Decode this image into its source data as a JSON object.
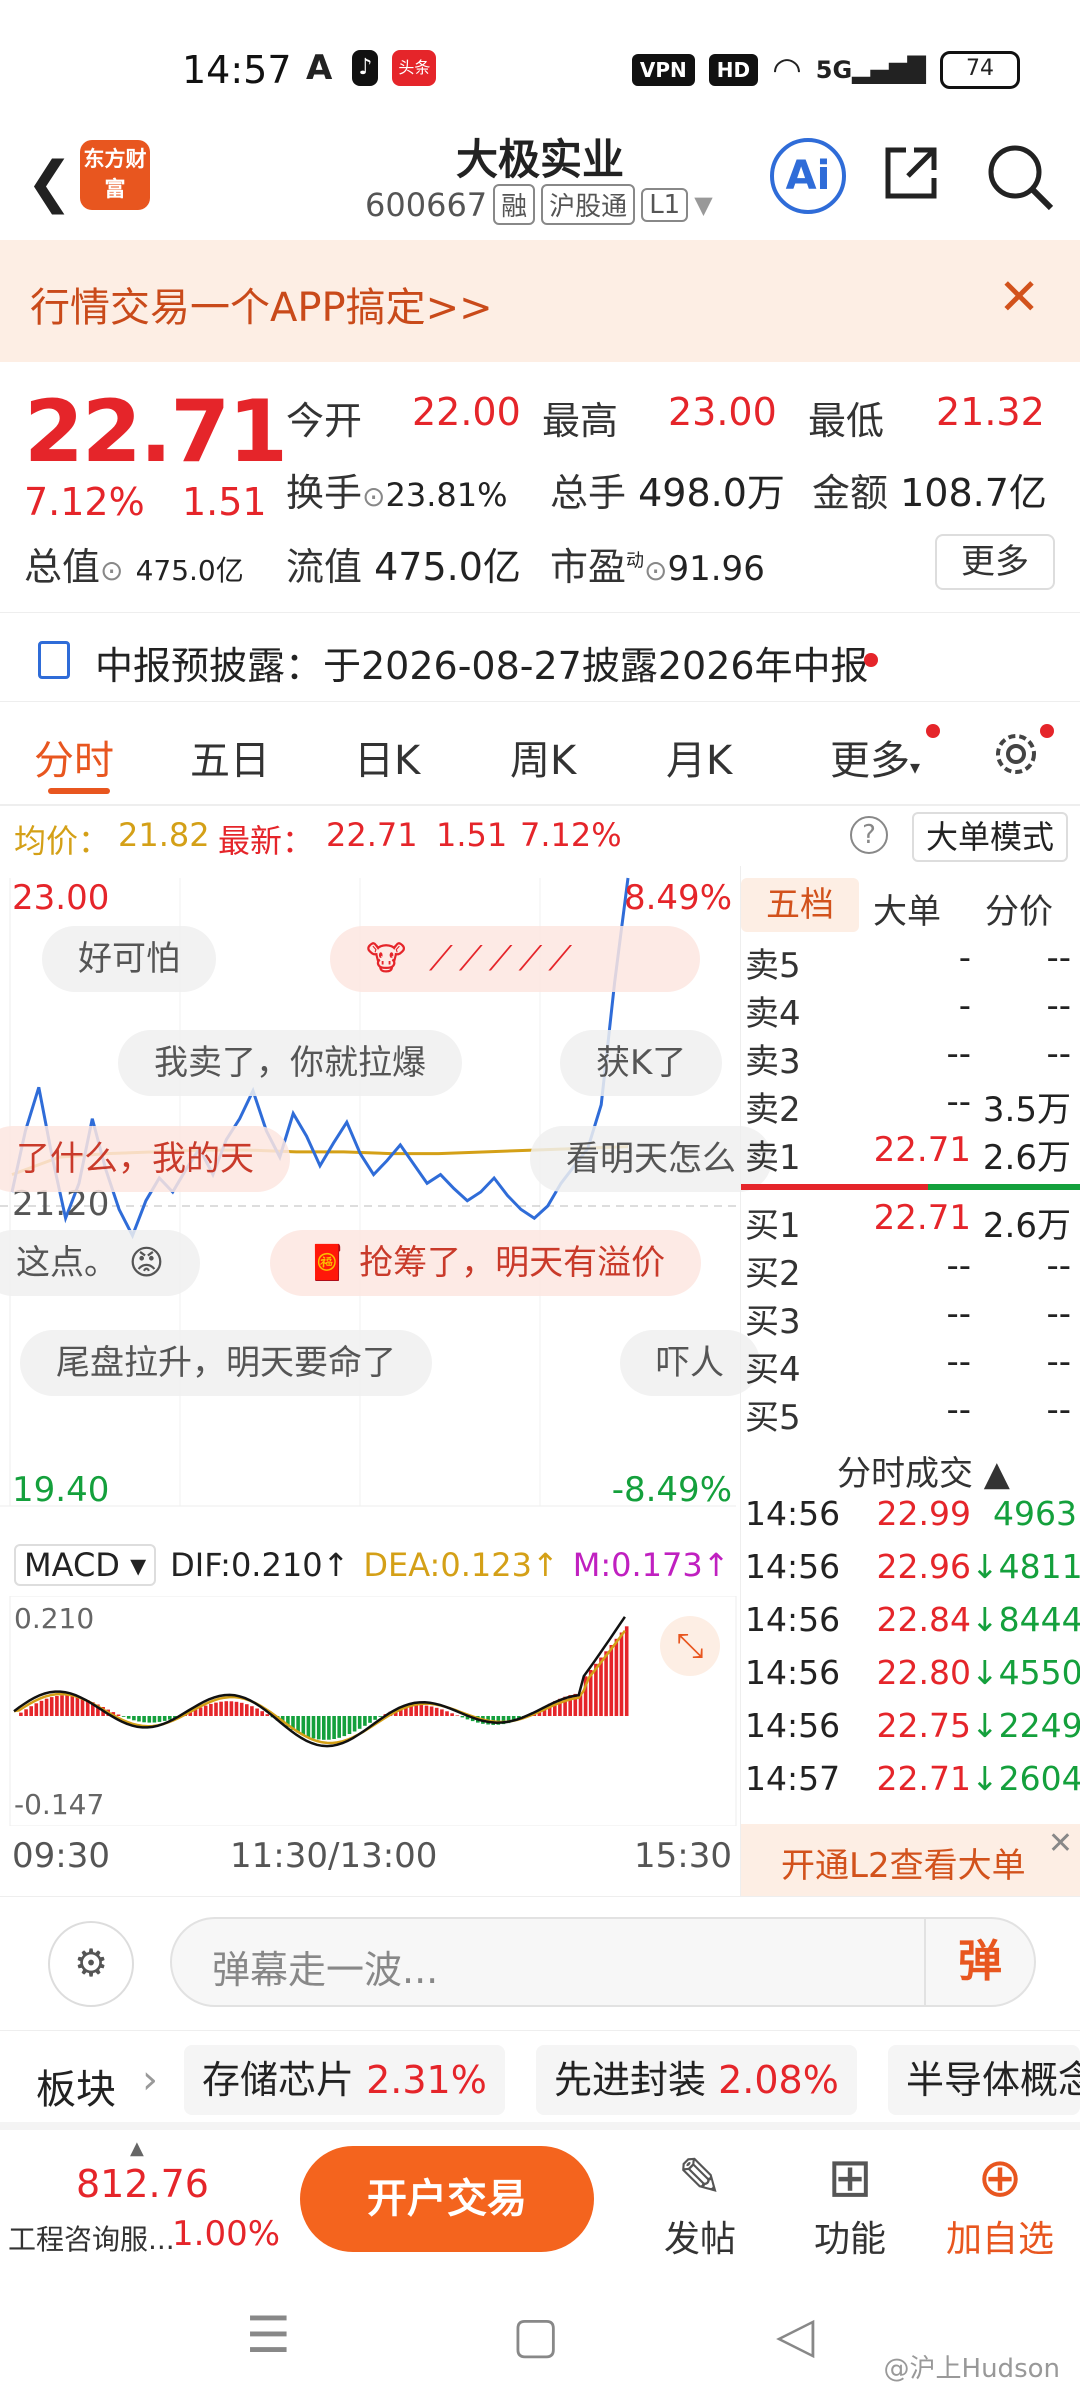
{
  "status": {
    "time": "14:57",
    "app_icons": [
      "A",
      "♪",
      "头条"
    ],
    "vpn": "VPN",
    "hd": "HD",
    "network": "5G",
    "battery": "74"
  },
  "header": {
    "logo": "东方财富",
    "stock_name": "大极实业",
    "stock_code": "600667",
    "tags": [
      "融",
      "沪股通",
      "L1"
    ]
  },
  "promo": {
    "text": "行情交易一个APP搞定>>"
  },
  "quote": {
    "price": "22.71",
    "change_pct": "7.12%",
    "change": "1.51",
    "open_label": "今开",
    "open": "22.00",
    "high_label": "最高",
    "high": "23.00",
    "low_label": "最低",
    "low": "21.32",
    "turnover_label": "换手",
    "turnover": "23.81%",
    "volume_label": "总手",
    "volume": "498.0万",
    "amount_label": "金额",
    "amount": "108.7亿",
    "mktcap_label": "总值",
    "mktcap": "475.0亿",
    "float_label": "流值",
    "float": "475.0亿",
    "pe_label": "市盈",
    "pe_sup": "动",
    "pe": "91.96",
    "more": "更多"
  },
  "notice": {
    "text": "中报预披露：于2026-08-27披露2026年中报"
  },
  "tabs": [
    "分时",
    "五日",
    "日K",
    "周K",
    "月K",
    "更多"
  ],
  "infoline": {
    "avg_label": "均价：",
    "avg": "21.82",
    "latest_label": "最新：",
    "latest": "22.71",
    "chg": "1.51",
    "pct": "7.12%",
    "help": "?",
    "bigmode": "大单模式"
  },
  "chart_axis": {
    "y_top": "23.00",
    "y_top_pct": "8.49%",
    "y_mid": "21.20",
    "y_bottom": "19.40",
    "y_bottom_pct": "-8.49%"
  },
  "danmu": [
    "好可怕",
    "我卖了，你就拉爆",
    "获K了",
    "了什么，我的天",
    "看明天怎么",
    "这点。",
    "抢筹了，明天有溢价",
    "尾盘拉升，明天要命了",
    "吓人"
  ],
  "orderbook": {
    "tabs": [
      "五档",
      "大单",
      "分价"
    ],
    "sells": [
      {
        "label": "卖5",
        "price": "-",
        "vol": "--"
      },
      {
        "label": "卖4",
        "price": "-",
        "vol": "--"
      },
      {
        "label": "卖3",
        "price": "--",
        "vol": "--"
      },
      {
        "label": "卖2",
        "price": "--",
        "vol": "3.5万"
      },
      {
        "label": "卖1",
        "price": "22.71",
        "vol": "2.6万"
      }
    ],
    "buys": [
      {
        "label": "买1",
        "price": "22.71",
        "vol": "2.6万"
      },
      {
        "label": "买2",
        "price": "--",
        "vol": "--"
      },
      {
        "label": "买3",
        "price": "--",
        "vol": "--"
      },
      {
        "label": "买4",
        "price": "--",
        "vol": "--"
      },
      {
        "label": "买5",
        "price": "--",
        "vol": "--"
      }
    ],
    "trades_title": "分时成交",
    "trades": [
      {
        "time": "14:56",
        "price": "22.99",
        "vol": "4963",
        "dir": "up"
      },
      {
        "time": "14:56",
        "price": "22.96",
        "vol": "4811",
        "dir": "down"
      },
      {
        "time": "14:56",
        "price": "22.84",
        "vol": "8444",
        "dir": "down"
      },
      {
        "time": "14:56",
        "price": "22.80",
        "vol": "4550",
        "dir": "down"
      },
      {
        "time": "14:56",
        "price": "22.75",
        "vol": "2249",
        "dir": "down"
      },
      {
        "time": "14:57",
        "price": "22.71",
        "vol": "2604",
        "dir": "down"
      }
    ],
    "l2": "开通L2查看大单"
  },
  "macd": {
    "select": "MACD",
    "dif": "DIF:0.210",
    "dea": "DEA:0.123",
    "m": "M:0.173",
    "y_top": "0.210",
    "y_bottom": "-0.147"
  },
  "time_axis": [
    "09:30",
    "11:30/13:00",
    "15:30"
  ],
  "comment": {
    "placeholder": "弹幕走一波...",
    "dan": "弹"
  },
  "sectors": {
    "label": "板块",
    "items": [
      {
        "name": "存储芯片",
        "pct": "2.31%"
      },
      {
        "name": "先进封装",
        "pct": "2.08%"
      },
      {
        "name": "半导体概念",
        "pct": ""
      }
    ]
  },
  "bottom": {
    "index_value": "812.76",
    "index_name": "工程咨询服...",
    "index_chg": "1.00%",
    "open_account": "开户交易",
    "post": "发帖",
    "func": "功能",
    "add": "加自选"
  },
  "watermark": "@沪上Hudson",
  "colors": {
    "up": "#e5252a",
    "down": "#14a03c",
    "accent": "#e8561f",
    "price_line": "#2f6cd8",
    "avg_line": "#d4a017"
  }
}
